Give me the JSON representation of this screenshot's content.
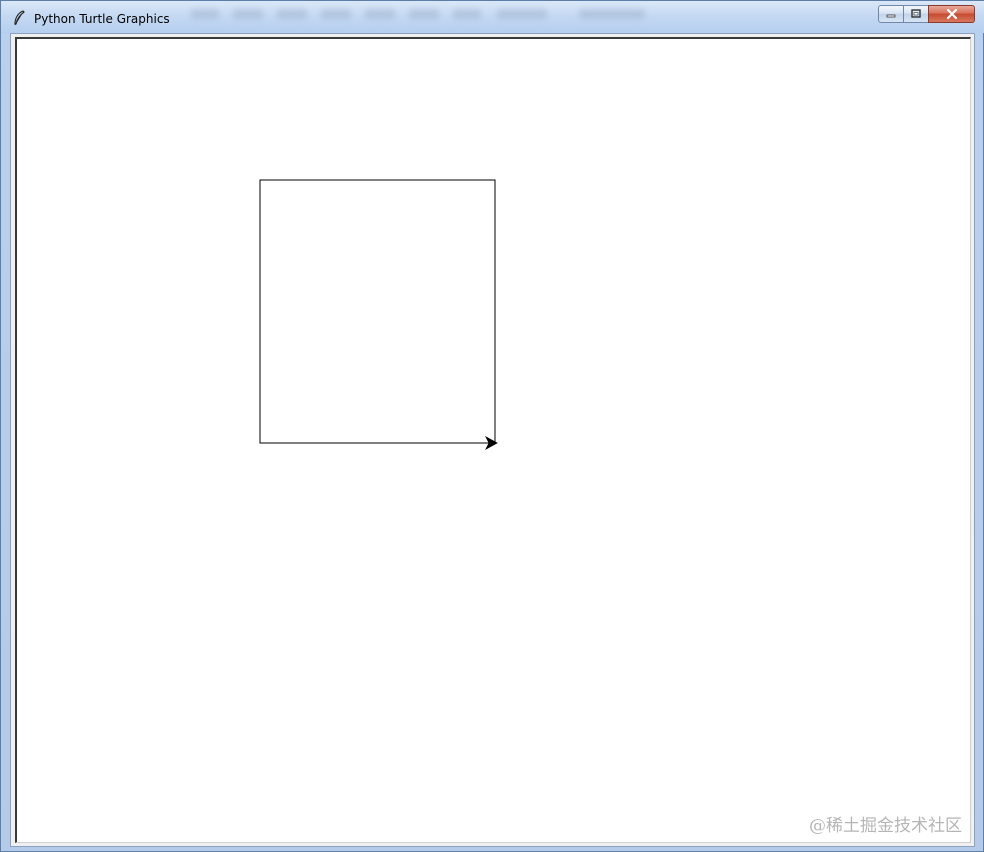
{
  "window": {
    "title": "Python Turtle Graphics",
    "icon": "feather-icon",
    "buttons": {
      "minimize": "minimize-icon",
      "maximize": "maximize-icon",
      "close": "close-icon"
    }
  },
  "canvas": {
    "background": "#ffffff",
    "pen_color": "#000000",
    "turtle_shape": "arrow",
    "turtle_heading": "east"
  },
  "watermark": "@稀土掘金技术社区",
  "colors": {
    "close_button": "#c44a30",
    "titlebar": "#c3d8f2",
    "frame_border": "#5b7fa8"
  }
}
